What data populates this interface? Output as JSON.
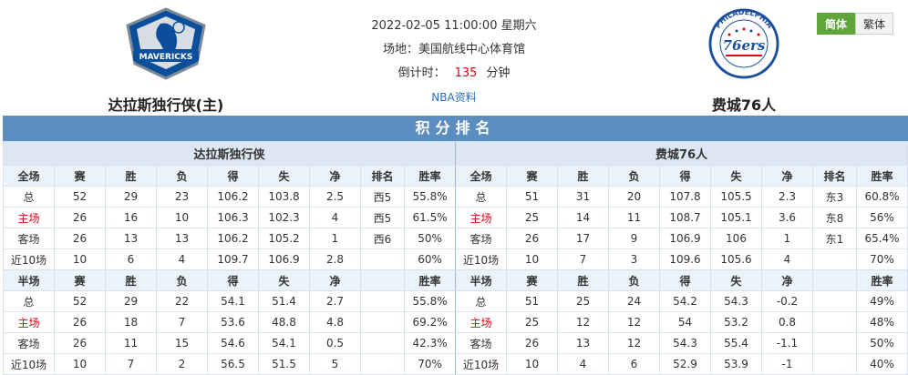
{
  "match": {
    "datetime": "2022-02-05 11:00:00 星期六",
    "venue_label": "场地：",
    "venue": "美国航线中心体育馆",
    "countdown_label": "倒计时：",
    "countdown_value": "135",
    "countdown_unit": "分钟",
    "data_link": "NBA资料"
  },
  "home_team": {
    "name": "达拉斯独行侠(主)",
    "logo_text": "MAVERICKS",
    "color": "#0b4f9c"
  },
  "away_team": {
    "name": "费城76人",
    "logo_text": "PHILADELPHIA",
    "logo_number": "76ers",
    "color": "#1d4f9f"
  },
  "lang": {
    "simplified": "简体",
    "traditional": "繁体"
  },
  "title": "积分排名",
  "colors": {
    "title_bar": "#5b8dbf",
    "accent_red": "#e60012",
    "lang_active": "#5ea63b"
  },
  "left": {
    "team": "达拉斯独行侠",
    "full_head": [
      "全场",
      "赛",
      "胜",
      "负",
      "得",
      "失",
      "净",
      "排名",
      "胜率"
    ],
    "full": [
      [
        "总",
        "52",
        "29",
        "23",
        "106.2",
        "103.8",
        "2.5",
        "西5",
        "55.8%"
      ],
      [
        "主场",
        "26",
        "16",
        "10",
        "106.3",
        "102.3",
        "4",
        "西5",
        "61.5%"
      ],
      [
        "客场",
        "26",
        "13",
        "13",
        "106.2",
        "105.2",
        "1",
        "西6",
        "50%"
      ],
      [
        "近10场",
        "10",
        "6",
        "4",
        "109.7",
        "106.9",
        "2.8",
        "",
        "60%"
      ]
    ],
    "half_head": [
      "半场",
      "赛",
      "胜",
      "负",
      "得",
      "失",
      "净",
      "",
      "胜率"
    ],
    "half": [
      [
        "总",
        "52",
        "29",
        "22",
        "54.1",
        "51.4",
        "2.7",
        "",
        "55.8%"
      ],
      [
        "主场",
        "26",
        "18",
        "7",
        "53.6",
        "48.8",
        "4.8",
        "",
        "69.2%"
      ],
      [
        "客场",
        "26",
        "11",
        "15",
        "54.6",
        "54.1",
        "0.5",
        "",
        "42.3%"
      ],
      [
        "近10场",
        "10",
        "7",
        "2",
        "56.5",
        "51.5",
        "5",
        "",
        "70%"
      ]
    ]
  },
  "right": {
    "team": "费城76人",
    "full_head": [
      "全场",
      "赛",
      "胜",
      "负",
      "得",
      "失",
      "净",
      "排名",
      "胜率"
    ],
    "full": [
      [
        "总",
        "51",
        "31",
        "20",
        "107.8",
        "105.5",
        "2.3",
        "东3",
        "60.8%"
      ],
      [
        "主场",
        "25",
        "14",
        "11",
        "108.7",
        "105.1",
        "3.6",
        "东8",
        "56%"
      ],
      [
        "客场",
        "26",
        "17",
        "9",
        "106.9",
        "106",
        "1",
        "东1",
        "65.4%"
      ],
      [
        "近10场",
        "10",
        "7",
        "3",
        "109.6",
        "105.6",
        "4",
        "",
        "70%"
      ]
    ],
    "half_head": [
      "半场",
      "赛",
      "胜",
      "负",
      "得",
      "失",
      "净",
      "",
      "胜率"
    ],
    "half": [
      [
        "总",
        "51",
        "25",
        "24",
        "54.2",
        "54.3",
        "-0.2",
        "",
        "49%"
      ],
      [
        "主场",
        "25",
        "12",
        "12",
        "54",
        "53.2",
        "0.8",
        "",
        "48%"
      ],
      [
        "客场",
        "26",
        "13",
        "12",
        "54.3",
        "55.4",
        "-1.1",
        "",
        "50%"
      ],
      [
        "近10场",
        "10",
        "4",
        "6",
        "52.9",
        "53.9",
        "-1",
        "",
        "40%"
      ]
    ]
  }
}
